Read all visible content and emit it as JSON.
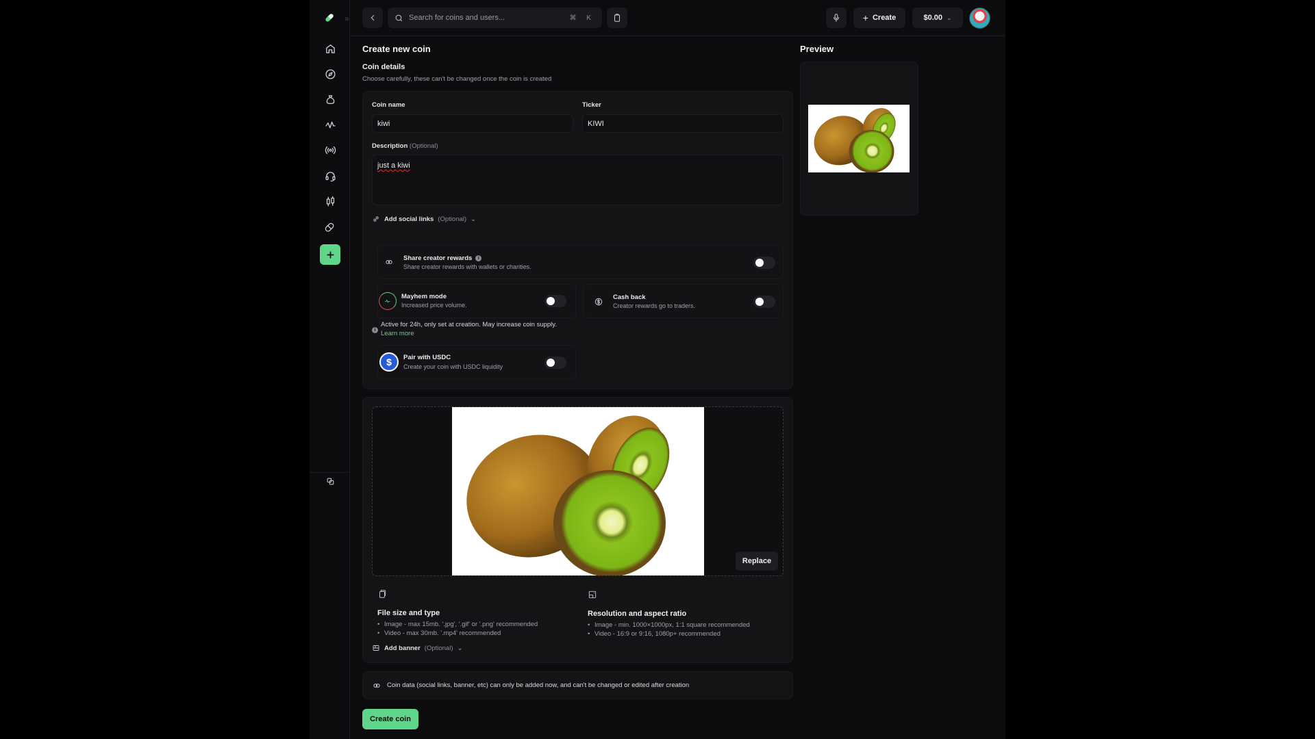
{
  "topbar": {
    "search_placeholder": "Search for coins and users...",
    "search_shortcut": "⌘ K",
    "create_label": "Create",
    "balance": "$0.00"
  },
  "sidebar": {
    "items": [
      {
        "icon": "home-icon"
      },
      {
        "icon": "compass-icon"
      },
      {
        "icon": "money-bag-icon"
      },
      {
        "icon": "activity-icon"
      },
      {
        "icon": "broadcast-icon"
      },
      {
        "icon": "headset-icon"
      },
      {
        "icon": "candlestick-icon"
      },
      {
        "icon": "pill-icon"
      },
      {
        "icon": "plus-icon"
      }
    ]
  },
  "form": {
    "title": "Create new coin",
    "section_title": "Coin details",
    "section_note": "Choose carefully, these can't be changed once the coin is created",
    "coin_name_label": "Coin name",
    "coin_name_value": "kiwi",
    "ticker_label": "Ticker",
    "ticker_value": "KIWI",
    "description_label": "Description",
    "optional_text": "(Optional)",
    "description_value": "just a kiwi",
    "social_links_label": "Add social links",
    "share_rewards_title": "Share creator rewards",
    "share_rewards_desc": "Share creator rewards with wallets or charities.",
    "mayhem_title": "Mayhem mode",
    "mayhem_desc": "Increased price volume.",
    "cashback_title": "Cash back",
    "cashback_desc": "Creator rewards go to traders.",
    "mayhem_note": "Active for 24h, only set at creation. May increase coin supply.",
    "learn_more": "Learn more",
    "usdc_title": "Pair with USDC",
    "usdc_desc": "Create your coin with USDC liquidity",
    "toggles": {
      "share_rewards": false,
      "mayhem": false,
      "cashback": false,
      "usdc": false
    }
  },
  "upload": {
    "replace_label": "Replace",
    "file_title": "File size and type",
    "file_lines": [
      "Image - max 15mb. '.jpg', '.gif' or '.png' recommended",
      "Video - max 30mb. '.mp4' recommended"
    ],
    "res_title": "Resolution and aspect ratio",
    "res_lines": [
      "Image - min. 1000×1000px, 1:1 square recommended",
      "Video - 16:9 or 9:16, 1080p+ recommended"
    ],
    "banner_label": "Add banner"
  },
  "footer": {
    "note": "Coin data (social links, banner, etc) can only be added now, and can't be changed or edited after creation",
    "submit_label": "Create coin"
  },
  "preview": {
    "title": "Preview"
  },
  "colors": {
    "accent": "#5fd68a",
    "background": "#0c0c0e",
    "card": "#141417"
  }
}
